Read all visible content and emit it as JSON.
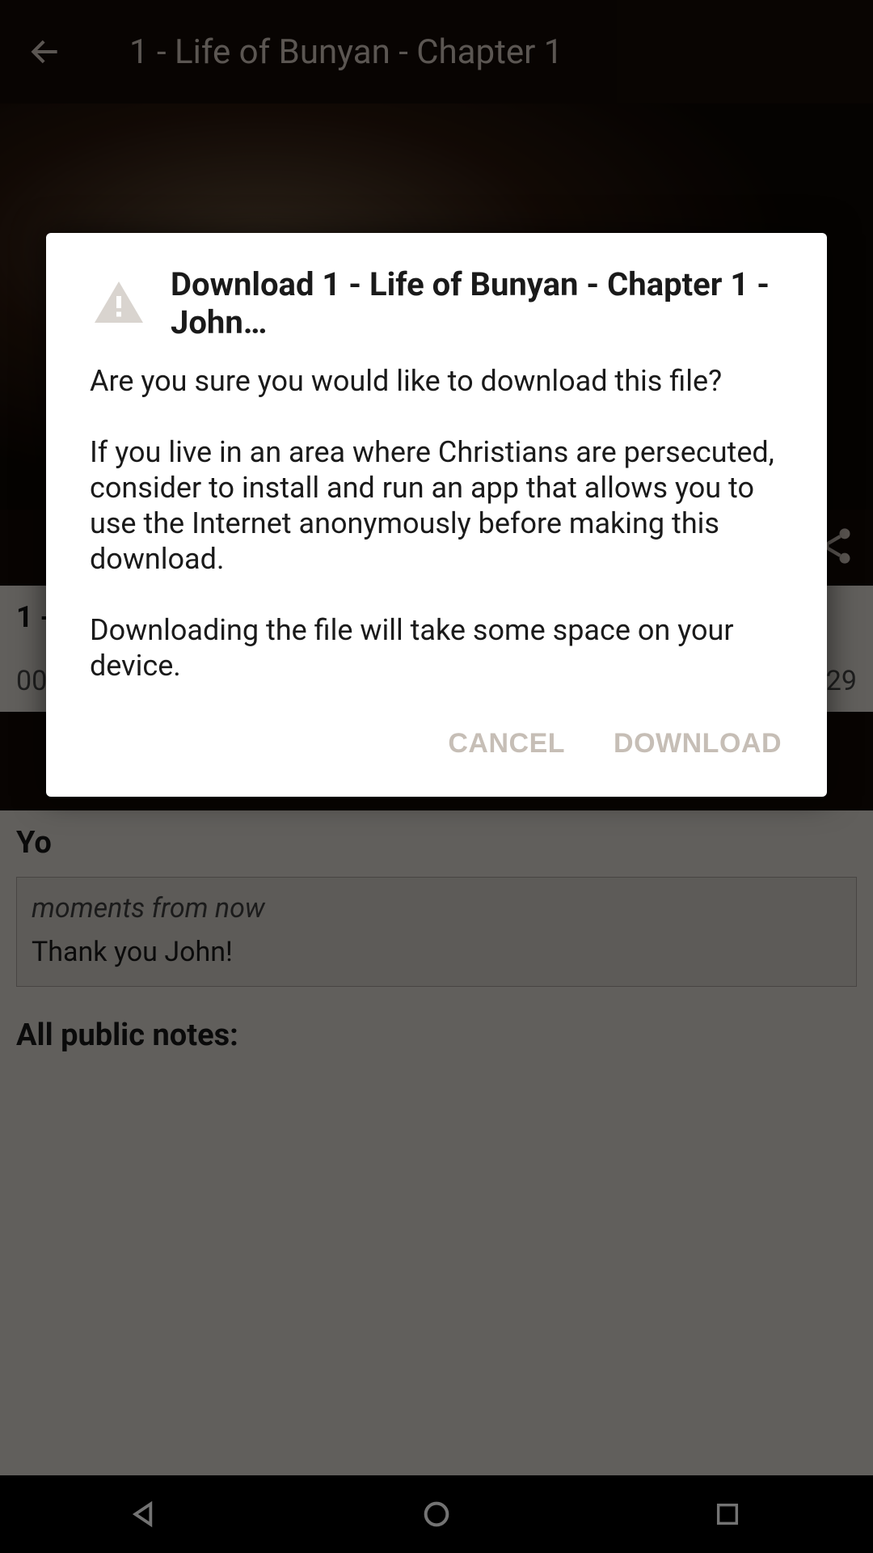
{
  "appbar": {
    "title": "1 - Life of Bunyan - Chapter 1"
  },
  "player": {
    "track_title_partial": "1 -",
    "time_left": "00",
    "time_right": "29"
  },
  "notes": {
    "your_heading_partial": "Yo",
    "public_heading": "All public notes:",
    "your_notes": [
      {
        "time": "moments from now",
        "text": "Thank you John!"
      }
    ]
  },
  "dialog": {
    "title": "Download 1 - Life of Bunyan - Chapter 1 - John…",
    "body": "Are you sure you would like to download this file?\n\nIf you live in an area where Christians are persecuted, consider to install and run an app that allows you to use the Internet anonymously before making this download.\n\nDownloading the file will take some space on your device.",
    "cancel": "CANCEL",
    "confirm": "DOWNLOAD"
  },
  "icons": {
    "back": "back-arrow-icon",
    "share": "share-icon",
    "warning": "warning-icon",
    "nav_back": "nav-back-icon",
    "nav_home": "nav-home-icon",
    "nav_recent": "nav-recent-icon"
  }
}
